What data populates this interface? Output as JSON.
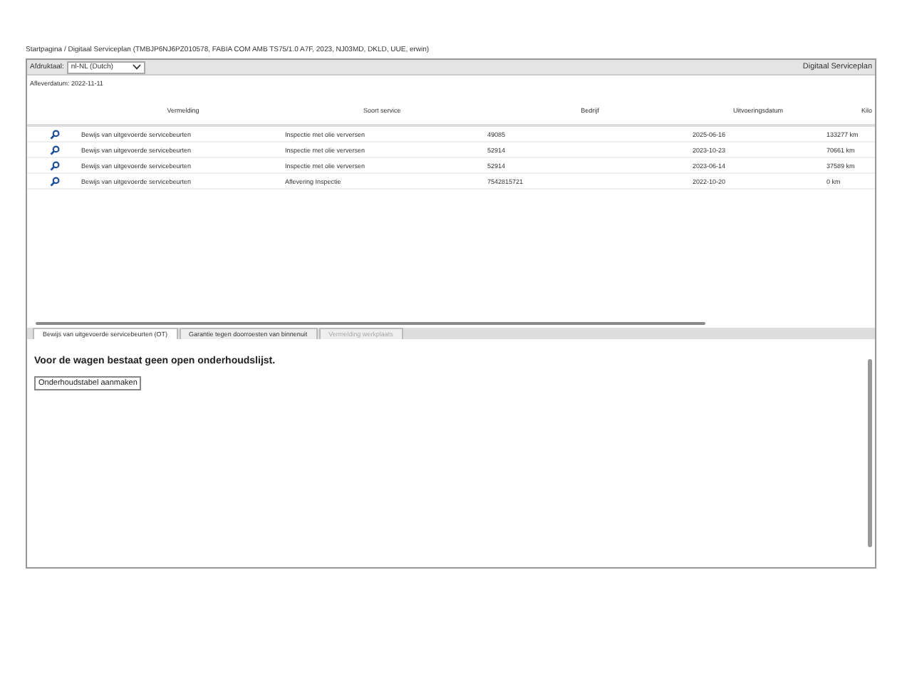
{
  "breadcrumb": "Startpagina / Digitaal Serviceplan (TMBJP6NJ6PZ010578, FABIA COM AMB TS75/1.0 A7F, 2023, NJ03MD, DKLD, UUE, erwin)",
  "toolbar": {
    "language_label": "Afdruktaal:",
    "language_value": "nl-NL (Dutch)",
    "title": "Digitaal Serviceplan"
  },
  "delivery_date": "Afleverdatum: 2022-11-11",
  "table": {
    "columns": [
      "Vermelding",
      "Soort service",
      "Bedrijf",
      "Uitvoeringsdatum",
      "Kilo"
    ],
    "rows": [
      {
        "cells": [
          "Bewijs van uitgevoerde servicebeurten",
          "Inspectie met olie verversen",
          "49085",
          "2025-06-16",
          "133277 km"
        ]
      },
      {
        "cells": [
          "Bewijs van uitgevoerde servicebeurten",
          "Inspectie met olie verversen",
          "52914",
          "2023-10-23",
          "70661 km"
        ]
      },
      {
        "cells": [
          "Bewijs van uitgevoerde servicebeurten",
          "Inspectie met olie verversen",
          "52914",
          "2023-06-14",
          "37589 km"
        ]
      },
      {
        "cells": [
          "Bewijs van uitgevoerde servicebeurten",
          "Aflevering Inspectie",
          "7542815721",
          "2022-10-20",
          "0 km"
        ]
      }
    ]
  },
  "tabs": [
    {
      "label": "Bewijs van uitgevoerde servicebeurten (OT)",
      "selected": true,
      "disabled": false
    },
    {
      "label": "Garantie tegen doorroesten van binnenuit",
      "selected": false,
      "disabled": false
    },
    {
      "label": "Vermelding werkplaats",
      "selected": false,
      "disabled": true
    }
  ],
  "message": "Voor de wagen bestaat geen open onderhoudslijst.",
  "create_button": "Onderhoudstabel aanmaken"
}
